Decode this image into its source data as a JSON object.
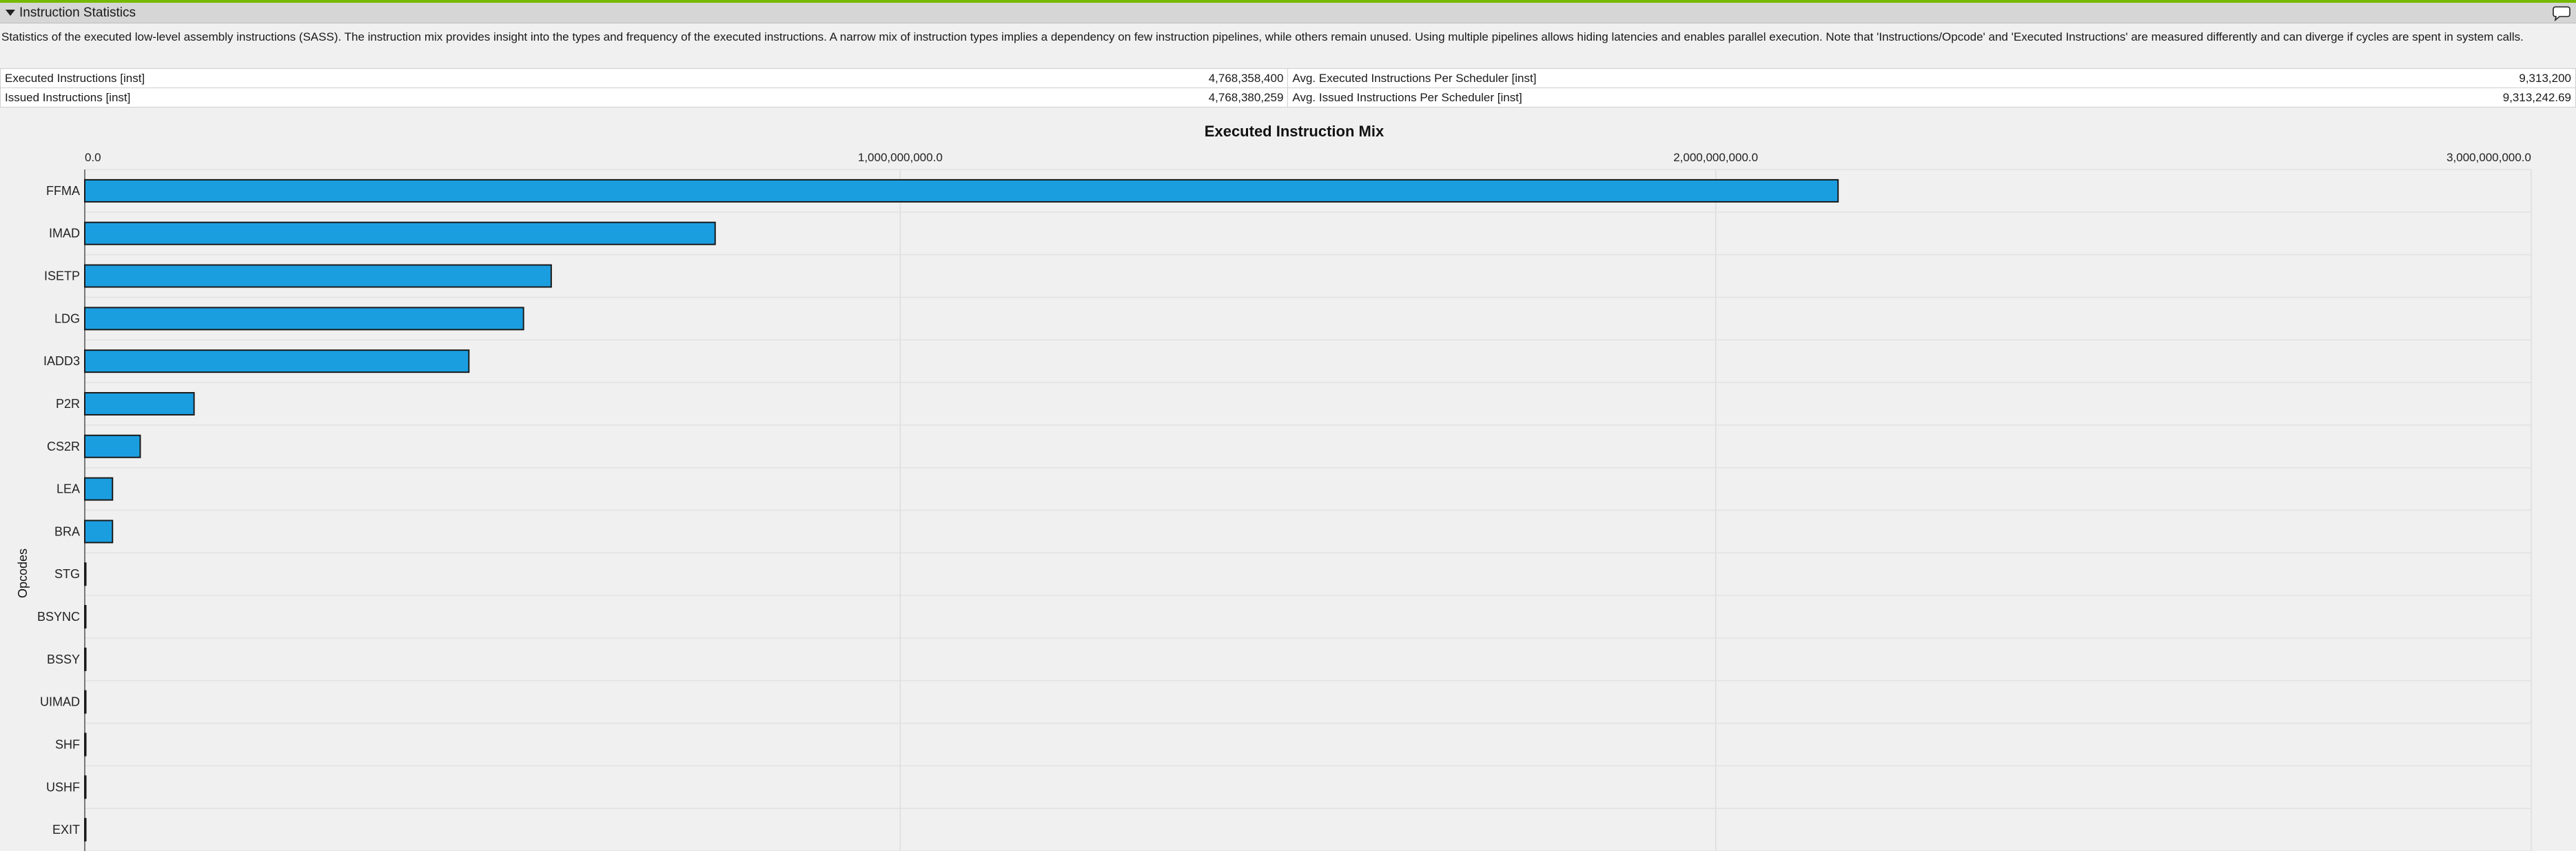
{
  "section": {
    "title": "Instruction Statistics",
    "description": "Statistics of the executed low-level assembly instructions (SASS). The instruction mix provides insight into the types and frequency of the executed instructions. A narrow mix of instruction types implies a dependency on few instruction pipelines, while others remain unused. Using multiple pipelines allows hiding latencies and enables parallel execution. Note that 'Instructions/Opcode' and 'Executed Instructions' are measured differently and can diverge if cycles are spent in system calls."
  },
  "metrics": [
    {
      "label": "Executed Instructions [inst]",
      "value": "4,768,358,400",
      "label2": "Avg. Executed Instructions Per Scheduler [inst]",
      "value2": "9,313,200"
    },
    {
      "label": "Issued Instructions [inst]",
      "value": "4,768,380,259",
      "label2": "Avg. Issued Instructions Per Scheduler [inst]",
      "value2": "9,313,242.69"
    }
  ],
  "colors": {
    "accent": "#76b900",
    "bar": "#1b9ee0",
    "bar_stroke": "#1a1a1a"
  },
  "icons": {
    "collapse": "triangle-down-icon",
    "comment": "speech-bubble-icon"
  },
  "chart_data": {
    "type": "bar",
    "orientation": "horizontal",
    "title": "Executed Instruction Mix",
    "ylabel": "Opcodes",
    "xlabel": "",
    "xlim": [
      0,
      3000000000
    ],
    "x_ticks": [
      0,
      1000000000,
      2000000000,
      3000000000
    ],
    "x_tick_labels": [
      "0.0",
      "1,000,000,000.0",
      "2,000,000,000.0",
      "3,000,000,000.0"
    ],
    "tick_position": "top",
    "grid": true,
    "categories": [
      "FFMA",
      "IMAD",
      "ISETP",
      "LDG",
      "IADD3",
      "P2R",
      "CS2R",
      "LEA",
      "BRA",
      "STG",
      "BSYNC",
      "BSSY",
      "UIMAD",
      "SHF",
      "USHF",
      "EXIT"
    ],
    "values": [
      2150000000,
      773000000,
      572000000,
      538000000,
      471000000,
      134000000,
      68000000,
      34000000,
      34000000,
      500000,
      300000,
      300000,
      300000,
      200000,
      200000,
      100000
    ]
  }
}
